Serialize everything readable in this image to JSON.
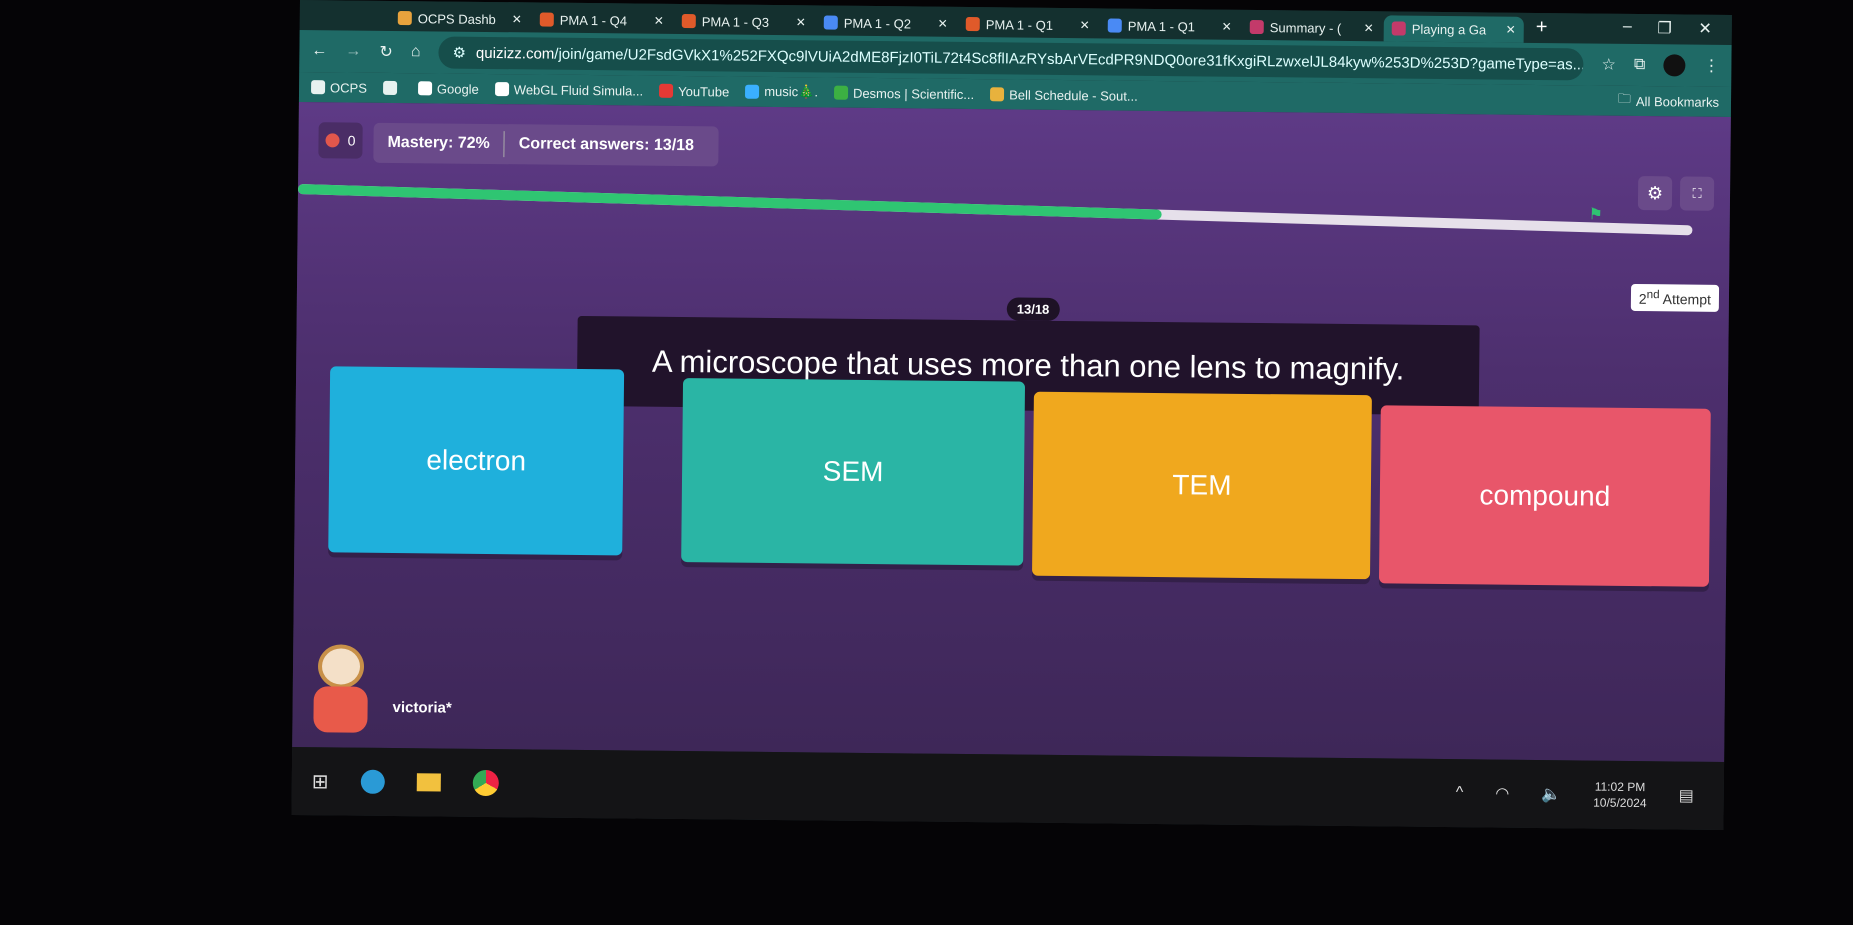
{
  "browser": {
    "tabs": [
      {
        "label": "OCPS Dashb",
        "icon": "ocps-icon",
        "color": "#e8a33d"
      },
      {
        "label": "PMA 1 - Q4",
        "icon": "spinner-icon",
        "color": "#e05a2a"
      },
      {
        "label": "PMA 1 - Q3",
        "icon": "spinner-icon",
        "color": "#e05a2a"
      },
      {
        "label": "PMA 1 - Q2",
        "icon": "docs-icon",
        "color": "#4a8af4"
      },
      {
        "label": "PMA 1 - Q1",
        "icon": "spinner-icon",
        "color": "#e05a2a"
      },
      {
        "label": "PMA 1 - Q1",
        "icon": "docs-icon",
        "color": "#4a8af4"
      },
      {
        "label": "Summary - (",
        "icon": "quizizz-icon",
        "color": "#c33a6a"
      },
      {
        "label": "Playing a Ga",
        "icon": "quizizz-icon",
        "color": "#c33a6a",
        "active": true
      }
    ],
    "url_domain": "quizizz.com",
    "url_path": "/join/game/U2FsdGVkX1%252FXQc9lVUiA2dME8FjzI0TiL72t4Sc8flIAzRYsbArVEcdPR9NDQ0ore31fKxgiRLzwxelJL84kyw%253D%253D?gameType=as...",
    "bookmarks": [
      {
        "label": "OCPS",
        "icon": "folder-icon",
        "color": "#e8f2f0"
      },
      {
        "label": "",
        "icon": "apps-grid-icon",
        "color": "#e8f2f0"
      },
      {
        "label": "Google",
        "icon": "google-icon",
        "color": "#ffffff"
      },
      {
        "label": "WebGL Fluid Simula...",
        "icon": "webgl-icon",
        "color": "#ffffff"
      },
      {
        "label": "YouTube",
        "icon": "youtube-icon",
        "color": "#e53935"
      },
      {
        "label": "music🎄.",
        "icon": "soundcloud-icon",
        "color": "#3ab0ff"
      },
      {
        "label": "Desmos | Scientific...",
        "icon": "desmos-icon",
        "color": "#3cb043"
      },
      {
        "label": "Bell Schedule - Sout...",
        "icon": "calendar-icon",
        "color": "#e8b23d"
      }
    ],
    "all_bookmarks": "All Bookmarks"
  },
  "game": {
    "score": "0",
    "mastery": "Mastery: 72%",
    "correct": "Correct answers: 13/18",
    "progress": 0.72,
    "attempt_num": "2",
    "attempt_sup": "nd",
    "attempt_label": "Attempt",
    "counter": "13/18",
    "question": "A microscope that uses more than one lens to magnify.",
    "options": [
      {
        "label": "electron",
        "color": "#1fb0dc"
      },
      {
        "label": "SEM",
        "color": "#2ab5a5"
      },
      {
        "label": "TEM",
        "color": "#f0a81e"
      },
      {
        "label": "compound",
        "color": "#e8566a"
      }
    ],
    "player": "victoria*"
  },
  "taskbar": {
    "time": "11:02 PM",
    "date": "10/5/2024"
  }
}
